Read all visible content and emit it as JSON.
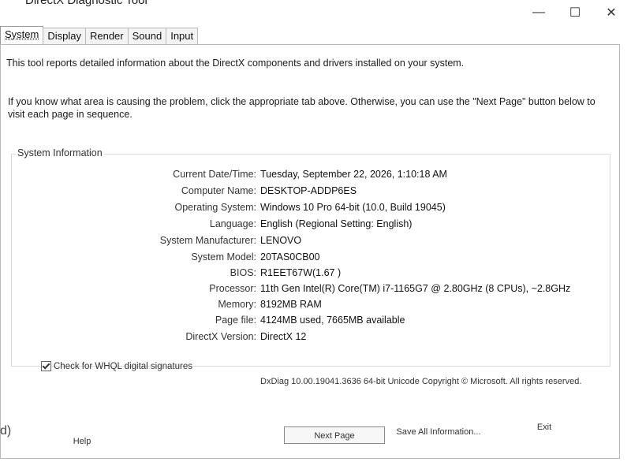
{
  "window": {
    "title": "DirectX Diagnostic Tool",
    "minimize": "—",
    "maximize": "☐",
    "close": "✕"
  },
  "tabs": [
    {
      "label": "System",
      "active": true
    },
    {
      "label": "Display"
    },
    {
      "label": "Render"
    },
    {
      "label": "Sound"
    },
    {
      "label": "Input"
    }
  ],
  "intro": "This tool reports detailed information about the DirectX components and drivers installed on your system.",
  "help_text": "If you know what area is causing the problem, click the appropriate tab above.  Otherwise, you can use the \"Next Page\" button below to visit each page in sequence.",
  "system_info": {
    "title": "System Information",
    "rows": [
      {
        "label": "Current Date/Time:",
        "value": "Tuesday, September 22, 2026, 1:10:18 AM"
      },
      {
        "label": "Computer Name:",
        "value": "DESKTOP-ADDP6ES"
      },
      {
        "label": "Operating System:",
        "value": "Windows 10 Pro 64-bit (10.0, Build 19045)"
      },
      {
        "label": "Language:",
        "value": "English (Regional Setting: English)"
      },
      {
        "label": "System Manufacturer:",
        "value": "LENOVO"
      },
      {
        "label": "System Model:",
        "value": "20TAS0CB00"
      },
      {
        "label": "BIOS:",
        "value": "R1EET67W(1.67 )"
      },
      {
        "label": "Processor:",
        "value": "11th Gen Intel(R) Core(TM) i7-1165G7 @ 2.80GHz (8 CPUs), ~2.8GHz"
      },
      {
        "label": "Memory:",
        "value": "8192MB RAM"
      },
      {
        "label": "Page file:",
        "value": "4124MB used, 7665MB available"
      },
      {
        "label": "DirectX Version:",
        "value": "DirectX 12"
      }
    ]
  },
  "whql": {
    "label": "Check for WHQL digital signatures",
    "checked": true
  },
  "copyright": "DxDiag 10.00.19041.3636 64-bit Unicode  Copyright © Microsoft. All rights reserved.",
  "buttons": {
    "help": "Help",
    "next_page": "Next Page",
    "save_all": "Save All Information...",
    "exit": "Exit"
  },
  "left_edge_glyph": "d)"
}
